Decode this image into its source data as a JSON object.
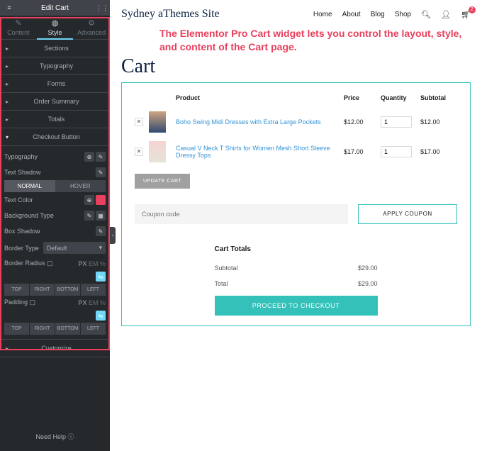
{
  "panel": {
    "title": "Edit Cart",
    "tabs": {
      "content": "Content",
      "style": "Style",
      "advanced": "Advanced"
    },
    "sections": {
      "sections": "Sections",
      "typography": "Typography",
      "forms": "Forms",
      "order_summary": "Order Summary",
      "totals": "Totals",
      "checkout": "Checkout Button",
      "customize": "Customize"
    },
    "checkout": {
      "typography": "Typography",
      "text_shadow": "Text Shadow",
      "normal": "NORMAL",
      "hover": "HOVER",
      "text_color": "Text Color",
      "bg_type": "Background Type",
      "box_shadow": "Box Shadow",
      "border_type": "Border Type",
      "border_type_val": "Default",
      "border_radius": "Border Radius",
      "px": "PX",
      "padding": "Padding",
      "top": "TOP",
      "right": "RIGHT",
      "bottom": "BOTTOM",
      "left": "LEFT",
      "link": "⇆"
    },
    "footer": "Need Help"
  },
  "site": {
    "title": "Sydney aThemes Site",
    "nav": {
      "home": "Home",
      "about": "About",
      "blog": "Blog",
      "shop": "Shop"
    },
    "cart_count": "2"
  },
  "callout": "The Elementor Pro Cart widget lets you control the layout, style, and content of the Cart page.",
  "page_title": "Cart",
  "table": {
    "head": {
      "product": "Product",
      "price": "Price",
      "qty": "Quantity",
      "subtotal": "Subtotal"
    },
    "rows": [
      {
        "name": "Boho Swing Midi Dresses with Extra Large Pockets",
        "price": "$12.00",
        "qty": "1",
        "sub": "$12.00"
      },
      {
        "name": "Casual V Neck T Shirts for Women Mesh Short Sleeve Dressy Tops",
        "price": "$17.00",
        "qty": "1",
        "sub": "$17.00"
      }
    ],
    "update": "UPDATE CART"
  },
  "coupon": {
    "ph": "Coupon code",
    "apply": "APPLY COUPON"
  },
  "totals": {
    "title": "Cart Totals",
    "subtotal_l": "Subtotal",
    "subtotal_v": "$29.00",
    "total_l": "Total",
    "total_v": "$29.00",
    "checkout": "PROCEED TO CHECKOUT"
  }
}
